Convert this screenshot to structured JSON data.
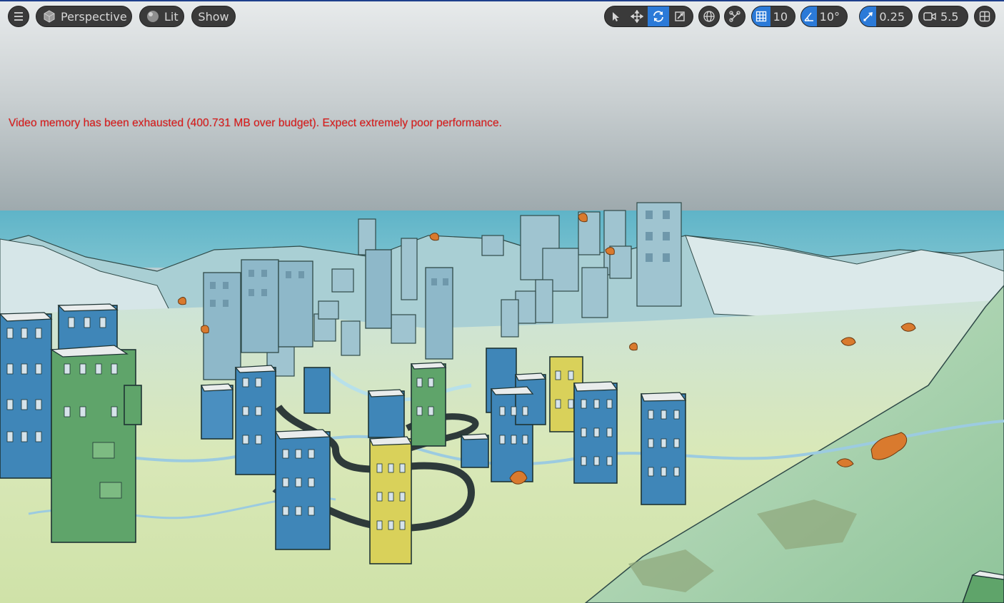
{
  "toolbar": {
    "view_mode": "Perspective",
    "lighting": "Lit",
    "show": "Show",
    "grid_snap": "10",
    "rotation_snap": "10°",
    "scale_snap": "0.25",
    "camera_speed": "5.5",
    "active_color": "#2b7ad8",
    "icons": [
      "hamburger-menu-icon",
      "cube-icon",
      "sphere-icon",
      "select-arrow-icon",
      "translate-icon",
      "rotate-icon",
      "scale-icon",
      "globe-icon",
      "surface-snap-icon",
      "grid-icon",
      "angle-icon",
      "scale-arrow-icon",
      "camera-icon",
      "layout-grid-icon"
    ]
  },
  "viewport": {
    "warning": "Video memory has been exhausted (400.731 MB over budget). Expect extremely poor performance.",
    "warning_color": "#e11a1a"
  }
}
